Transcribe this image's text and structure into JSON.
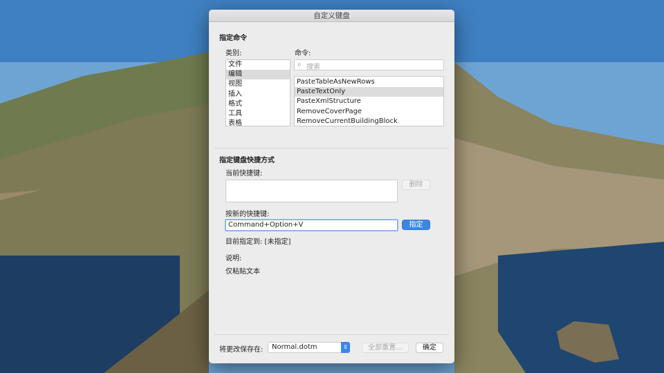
{
  "dialog": {
    "title": "自定义键盘"
  },
  "assign_command": {
    "heading": "指定命令",
    "categories_label": "类别:",
    "commands_label": "命令:",
    "categories": [
      "文件",
      "编辑",
      "视图",
      "插入",
      "格式",
      "工具",
      "表格"
    ],
    "selected_category": "编辑",
    "search_placeholder": "搜索",
    "commands": [
      "PasteTableAsNewRows",
      "PasteTextOnly",
      "PasteXmlStructure",
      "RemoveCoverPage",
      "RemoveCurrentBuildingBlock"
    ],
    "selected_command": "PasteTextOnly"
  },
  "shortcut": {
    "heading": "指定键盘快捷方式",
    "current_label": "当前快捷键:",
    "delete_button": "删除",
    "new_label": "按新的快捷键:",
    "new_value": "Command+Option+V",
    "assign_button": "指定",
    "current_assignment": "目前指定到: [未指定]",
    "description_label": "说明:",
    "description": "仅粘贴文本"
  },
  "footer": {
    "save_in_label": "将更改保存在:",
    "save_in_value": "Normal.dotm",
    "reset_all_button": "全部重置...",
    "ok_button": "确定"
  },
  "colors": {
    "accent": "#3b87e8"
  }
}
